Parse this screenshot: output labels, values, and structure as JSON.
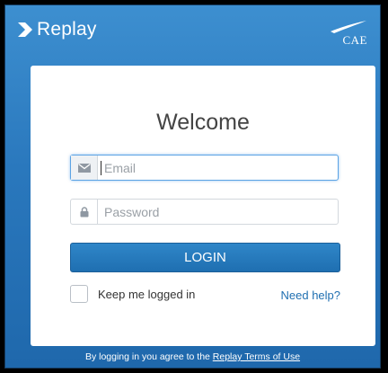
{
  "header": {
    "brand_name": "Replay",
    "partner_logo_text": "CAE"
  },
  "login": {
    "title": "Welcome",
    "email_placeholder": "Email",
    "email_value": "",
    "password_placeholder": "Password",
    "password_value": "",
    "login_label": "LOGIN",
    "remember_label": "Keep me logged in",
    "remember_checked": false,
    "help_label": "Need help?"
  },
  "footer": {
    "prefix": "By logging in you agree to the",
    "link_label": "Replay Terms of Use"
  },
  "colors": {
    "header_bg": "#2a78bd",
    "button_bg": "#1f6fb1",
    "link": "#1f6fb1",
    "focus_border": "#5ba3e4"
  },
  "icons": {
    "brand": "chevron-right-icon",
    "email": "envelope-icon",
    "password": "lock-icon",
    "partner": "cae-logo"
  }
}
